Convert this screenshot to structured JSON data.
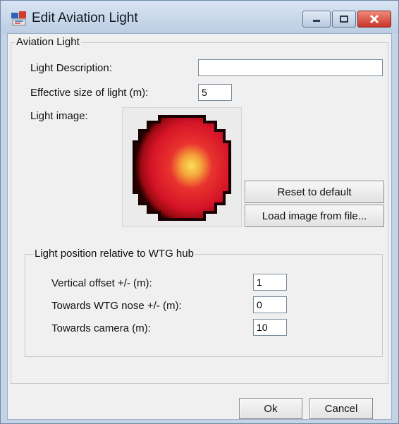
{
  "window": {
    "title": "Edit Aviation Light"
  },
  "aviation_light": {
    "group_title": "Aviation Light",
    "light_description": {
      "label": "Light Description:",
      "value": ""
    },
    "effective_size": {
      "label": "Effective size of light (m):",
      "value": "5"
    },
    "light_image_label": "Light image:",
    "reset_button": "Reset to default",
    "load_button": "Load image from file..."
  },
  "position": {
    "group_title": "Light position relative to WTG hub",
    "vertical_offset": {
      "label": "Vertical offset +/- (m):",
      "value": "1"
    },
    "towards_nose": {
      "label": "Towards WTG nose +/- (m):",
      "value": "0"
    },
    "towards_camera": {
      "label": "Towards camera (m):",
      "value": "10"
    }
  },
  "footer": {
    "ok": "Ok",
    "cancel": "Cancel"
  },
  "colors": {
    "accent": "#c4d3e6",
    "close": "#c8352a",
    "light_core": "#f6d23a",
    "light_body": "#e0182a",
    "light_edge": "#1a0000"
  }
}
